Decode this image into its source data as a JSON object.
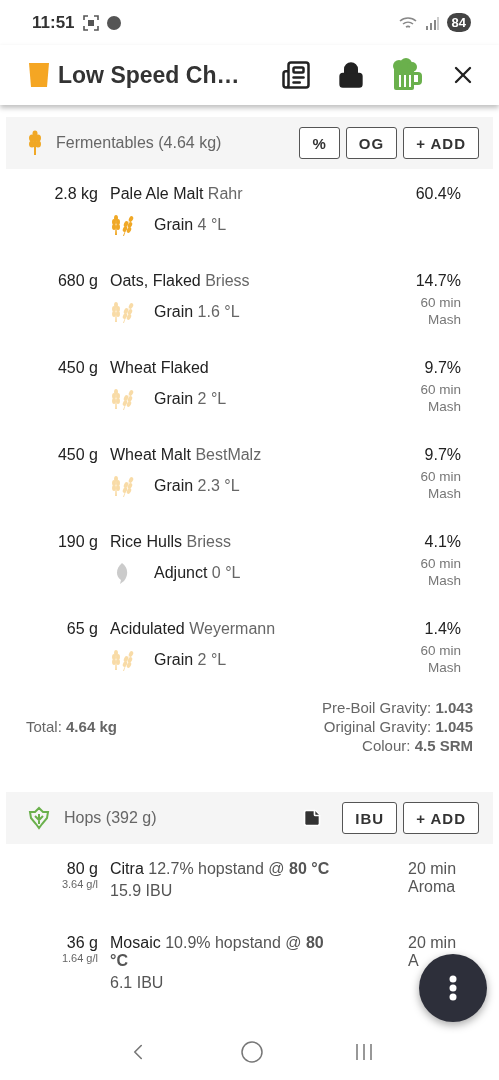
{
  "status_bar": {
    "time": "11:51",
    "battery": "84"
  },
  "app_bar": {
    "title": "Low Speed Ch…"
  },
  "fermentables": {
    "title": "Fermentables (4.64 kg)",
    "buttons": [
      "%",
      "OG",
      "+ ADD"
    ],
    "items": [
      {
        "amount": "2.8 kg",
        "name": "Pale Ale Malt",
        "supplier": "Rahr",
        "kind": "grain",
        "dim": false,
        "type": "Grain",
        "colour": "4 °L",
        "percent": "60.4%"
      },
      {
        "amount": "680 g",
        "name": "Oats, Flaked",
        "supplier": "Briess",
        "kind": "grain",
        "dim": true,
        "type": "Grain",
        "colour": "1.6 °L",
        "percent": "14.7%",
        "time": "60 min",
        "use": "Mash"
      },
      {
        "amount": "450 g",
        "name": "Wheat Flaked",
        "kind": "grain",
        "dim": true,
        "type": "Grain",
        "colour": "2 °L",
        "percent": "9.7%",
        "time": "60 min",
        "use": "Mash"
      },
      {
        "amount": "450 g",
        "name": "Wheat Malt",
        "supplier": "BestMalz",
        "kind": "grain",
        "dim": true,
        "type": "Grain",
        "colour": "2.3 °L",
        "percent": "9.7%",
        "time": "60 min",
        "use": "Mash"
      },
      {
        "amount": "190 g",
        "name": "Rice Hulls",
        "supplier": "Briess",
        "kind": "adjunct",
        "dim": true,
        "type": "Adjunct",
        "colour": "0 °L",
        "percent": "4.1%",
        "time": "60 min",
        "use": "Mash"
      },
      {
        "amount": "65 g",
        "name": "Acidulated",
        "supplier": "Weyermann",
        "kind": "grain",
        "dim": true,
        "type": "Grain",
        "colour": "2 °L",
        "percent": "1.4%",
        "time": "60 min",
        "use": "Mash"
      }
    ],
    "total": "Total: **4.64 kg**",
    "gravities": [
      "Pre-Boil Gravity: **1.043**",
      "Original Gravity: **1.045**",
      "Colour: **4.5 SRM**"
    ]
  },
  "hops": {
    "title": "Hops (392 g)",
    "buttons": [
      "IBU",
      "+ ADD"
    ],
    "items": [
      {
        "amount": "80 g",
        "rate": "3.64 g/l",
        "name": "Citra",
        "detail": "12.7% hopstand @ **80 °C**",
        "ibu": "15.9 IBU",
        "time": "20 min",
        "use": "Aroma"
      },
      {
        "amount": "36 g",
        "rate": "1.64 g/l",
        "name": "Mosaic",
        "detail": "10.9% hopstand @ **80 °C**",
        "ibu": "6.1 IBU",
        "time": "20 min",
        "use": "A"
      }
    ]
  }
}
